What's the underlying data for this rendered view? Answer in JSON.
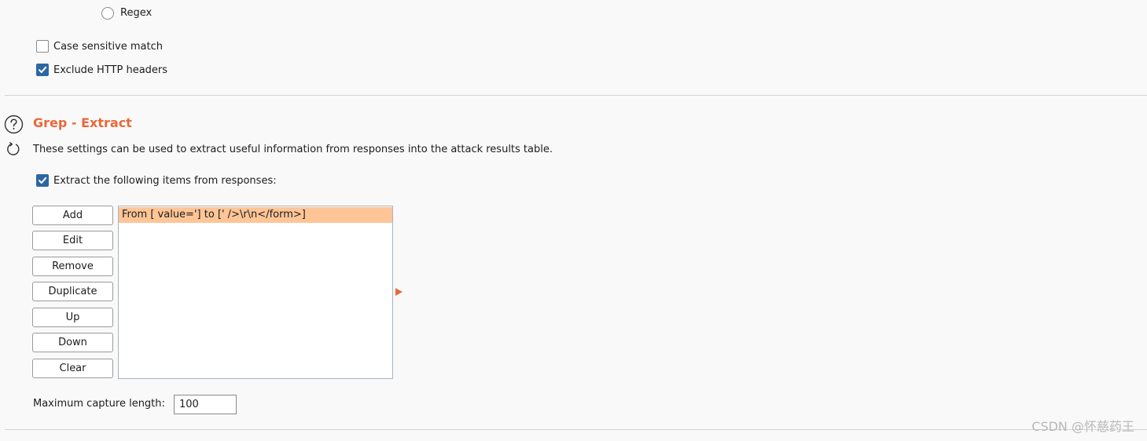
{
  "match_type": {
    "regex_label": "Regex"
  },
  "options": {
    "case_sensitive_label": "Case sensitive match",
    "case_sensitive_checked": false,
    "exclude_headers_label": "Exclude HTTP headers",
    "exclude_headers_checked": true
  },
  "grep_extract": {
    "title": "Grep - Extract",
    "description": "These settings can be used to extract useful information from responses into the attack results table.",
    "extract_label": "Extract the following items from responses:",
    "extract_checked": true,
    "buttons": {
      "add": "Add",
      "edit": "Edit",
      "remove": "Remove",
      "duplicate": "Duplicate",
      "up": "Up",
      "down": "Down",
      "clear": "Clear"
    },
    "items": [
      "From [ value='] to [' />\\r\\n</form>]"
    ],
    "max_capture_label": "Maximum capture length:",
    "max_capture_value": "100"
  },
  "watermark": "CSDN @怀慈药王",
  "colors": {
    "accent": "#e8693a",
    "checkbox_checked": "#2c67a4",
    "selected_row": "#ffc597"
  },
  "icons": {
    "help": "help-icon",
    "refresh": "refresh-icon",
    "expand": "expand-arrow-icon"
  }
}
